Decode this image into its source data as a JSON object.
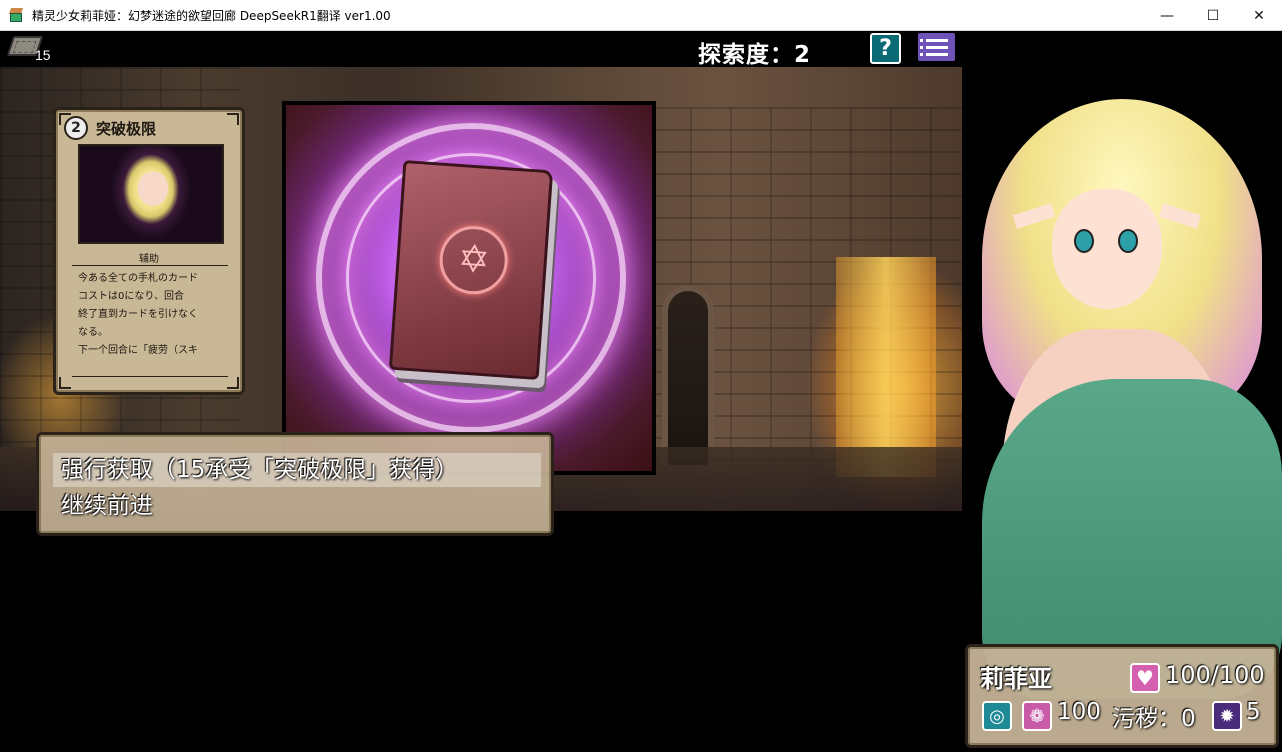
{
  "window": {
    "title": "精灵少女莉菲娅：幻梦迷途的欲望回廊 DeepSeekR1翻译 ver1.00",
    "minimize": "—",
    "maximize": "☐",
    "close": "✕"
  },
  "hud": {
    "deck_count": "15",
    "exploration": "探索度：2",
    "help_label": "?",
    "icons": [
      "deck-icon",
      "help-icon",
      "menu-icon"
    ]
  },
  "card": {
    "cost": "2",
    "name": "突破极限",
    "type": "辅助",
    "description": [
      "今ある全ての手札のカード",
      "コストは0になり、回合",
      "終了直到カードを引けなく",
      "なる。",
      "下一个回合に「疲劳（スキ"
    ]
  },
  "choices": [
    {
      "label": "强行获取（15承受「突破极限」获得）",
      "selected": true
    },
    {
      "label": "继续前进",
      "selected": false
    }
  ],
  "status": {
    "name": "莉菲亚",
    "hp": "100/100",
    "stat_a": "100",
    "filth": "污秽：0",
    "stat_c": "5"
  },
  "colors": {
    "help_button": "#0b6b74",
    "menu_button": "#6d52b8",
    "panel": "#c4b296",
    "hp_icon": "#d660b0"
  }
}
